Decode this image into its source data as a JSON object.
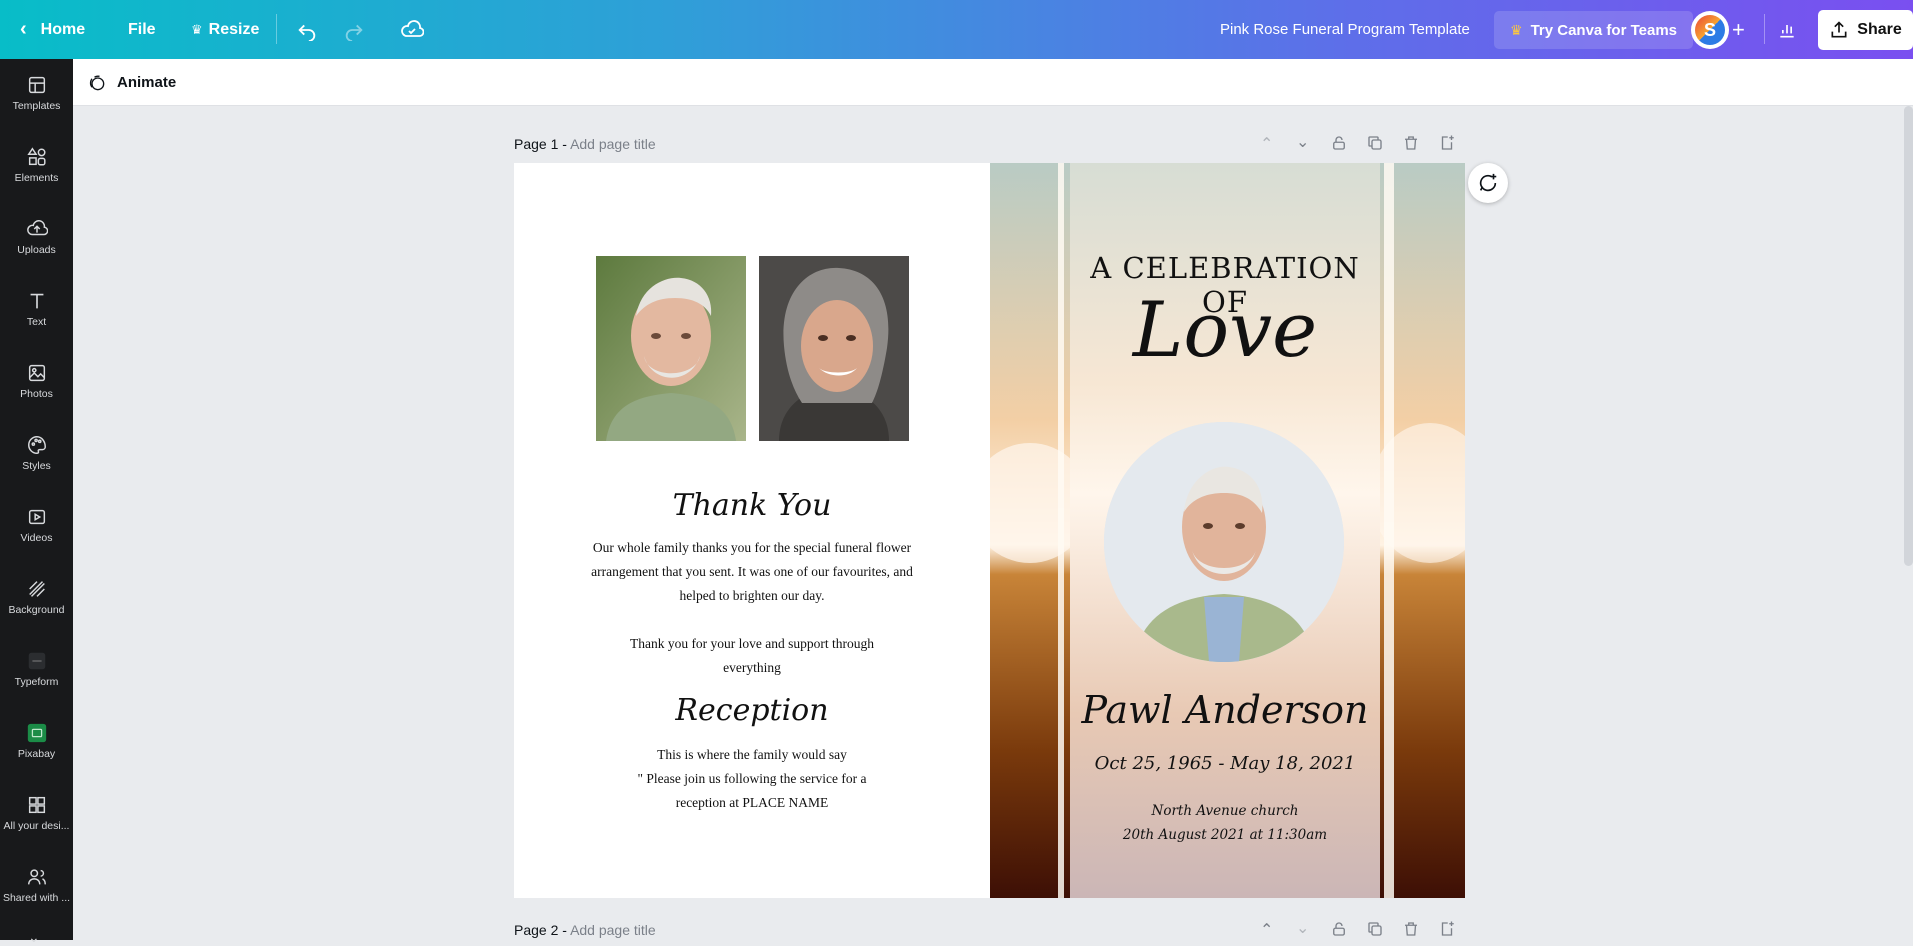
{
  "topbar": {
    "home_label": "Home",
    "file_label": "File",
    "resize_label": "Resize",
    "doc_title": "Pink Rose Funeral Program Template",
    "teams_label": "Try Canva for Teams",
    "share_label": "Share",
    "avatar_letter": "S"
  },
  "sidebar": {
    "items": [
      {
        "label": "Templates",
        "icon": "templates-icon"
      },
      {
        "label": "Elements",
        "icon": "elements-icon"
      },
      {
        "label": "Uploads",
        "icon": "uploads-icon"
      },
      {
        "label": "Text",
        "icon": "text-icon"
      },
      {
        "label": "Photos",
        "icon": "photos-icon"
      },
      {
        "label": "Styles",
        "icon": "styles-icon"
      },
      {
        "label": "Videos",
        "icon": "videos-icon"
      },
      {
        "label": "Background",
        "icon": "background-icon"
      },
      {
        "label": "Typeform",
        "icon": "typeform-icon"
      },
      {
        "label": "Pixabay",
        "icon": "pixabay-icon"
      },
      {
        "label": "All your desi...",
        "icon": "all-designs-icon"
      },
      {
        "label": "Shared with ...",
        "icon": "shared-icon"
      }
    ]
  },
  "toolbar": {
    "animate_label": "Animate"
  },
  "pages": [
    {
      "label": "Page 1 -",
      "title_placeholder": "Add page title"
    },
    {
      "label": "Page 2 -",
      "title_placeholder": "Add page title"
    }
  ],
  "design": {
    "thank_title": "Thank You",
    "thank_line1": "Our whole family thanks you for the special funeral flower",
    "thank_line2": "arrangement that you sent.  It was one of our favourites, and",
    "thank_line3": "helped to brighten our day.",
    "thank_line4": "Thank you for your love and support through",
    "thank_line5": "everything",
    "reception_title": "Reception",
    "reception_line1": "This is where the family would say",
    "reception_line2": "\" Please join us following the service for a",
    "reception_line3": "reception at PLACE NAME",
    "celebration": "A CELEBRATION OF",
    "love": "Love",
    "name": "Pawl Anderson",
    "dates": "Oct 25, 1965 - May 18, 2021",
    "venue": "North Avenue church",
    "service_time": "20th August 2021 at 11:30am"
  },
  "colors": {
    "topbar_start": "#08bdc8",
    "topbar_end": "#7a4ff0",
    "sidebar_bg": "#18191b",
    "canvas_bg": "#e9ebee"
  }
}
